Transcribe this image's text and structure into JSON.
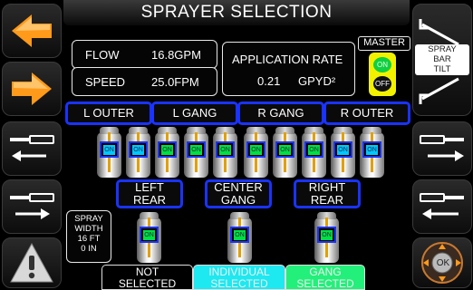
{
  "title": "SPRAYER SELECTION",
  "flow": {
    "label": "FLOW",
    "value": "16.8GPM"
  },
  "speed": {
    "label": "SPEED",
    "value": "25.0FPM"
  },
  "application_rate": {
    "label": "APPLICATION RATE",
    "value": "0.21",
    "unit": "GPYD²"
  },
  "master": {
    "label": "MASTER",
    "on_label": "ON",
    "off_label": "OFF"
  },
  "spray_bar_tilt": {
    "line1": "SPRAY",
    "line2": "BAR",
    "line3": "TILT"
  },
  "gangs": [
    "L OUTER",
    "L GANG",
    "R GANG",
    "R OUTER"
  ],
  "nozzles_top": [
    {
      "label": "ON",
      "color": "#00c8ff"
    },
    {
      "label": "ON",
      "color": "#00c8ff"
    },
    {
      "label": "ON",
      "color": "#00e040"
    },
    {
      "label": "ON",
      "color": "#00e040"
    },
    {
      "label": "ON",
      "color": "#00e040"
    },
    {
      "label": "ON",
      "color": "#00e040"
    },
    {
      "label": "ON",
      "color": "#00e040"
    },
    {
      "label": "ON",
      "color": "#00e040"
    },
    {
      "label": "ON",
      "color": "#00c8ff"
    },
    {
      "label": "ON",
      "color": "#00c8ff"
    }
  ],
  "rear_groups": [
    {
      "line1": "LEFT",
      "line2": "REAR"
    },
    {
      "line1": "CENTER",
      "line2": "GANG"
    },
    {
      "line1": "RIGHT",
      "line2": "REAR"
    }
  ],
  "nozzles_rear": [
    {
      "label": "ON",
      "color": "#00e040"
    },
    {
      "label": "ON",
      "color": "#00e040"
    },
    {
      "label": "ON",
      "color": "#00e040"
    }
  ],
  "spray_width": {
    "line1": "SPRAY",
    "line2": "WIDTH",
    "line3": "16 FT",
    "line4": "0 IN"
  },
  "legend": [
    {
      "line1": "NOT",
      "line2": "SELECTED",
      "bg": "#000000",
      "fg": "#ffffff"
    },
    {
      "line1": "INDIVIDUAL",
      "line2": "SELECTED",
      "bg": "#1ee8f0",
      "fg": "#f0f0f0"
    },
    {
      "line1": "GANG",
      "line2": "SELECTED",
      "bg": "#22f07a",
      "fg": "#f0f0f0"
    }
  ],
  "ok_label": "OK",
  "colors": {
    "arrow_orange": "#ff9a1a",
    "accent_blue": "#1a33ff",
    "master_yellow": "#f2f200"
  }
}
